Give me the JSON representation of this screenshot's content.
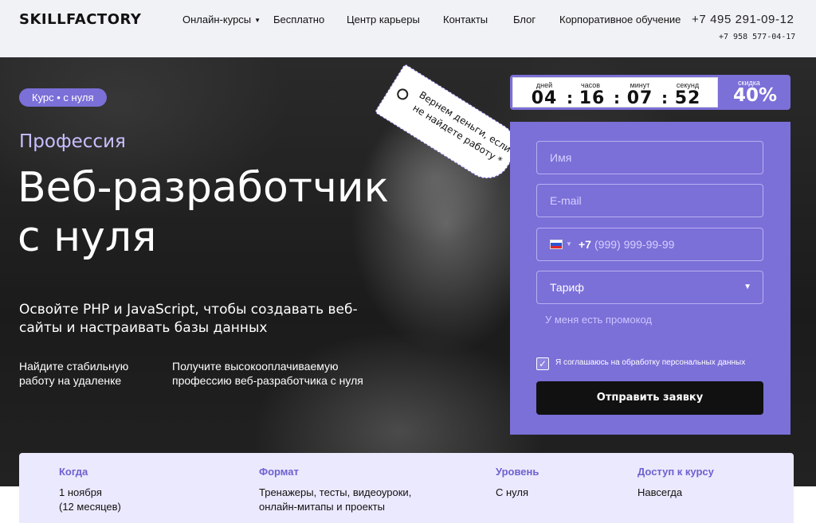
{
  "header": {
    "logo": "SKILLFACTORY",
    "nav": [
      {
        "label": "Онлайн-курсы",
        "has_dropdown": true
      },
      {
        "label": "Бесплатно"
      },
      {
        "label": "Центр карьеры"
      },
      {
        "label": "Контакты"
      },
      {
        "label": "Блог"
      },
      {
        "label": "Корпоративное обучение"
      }
    ],
    "phone_main": "+7 495 291-09-12",
    "phone_alt": "+7 958 577-04-17"
  },
  "hero": {
    "badge": "Курс • с нуля",
    "profession": "Профессия",
    "title_line1": "Веб-разработчик",
    "title_line2": "с нуля",
    "subtitle": "Освойте PHP и JavaScript, чтобы создавать веб-сайты и настраивать базы данных",
    "features": [
      "Найдите стабильную работу на удаленке",
      "Получите высокооплачиваемую профессию веб-разработчика с нуля"
    ],
    "tag_text": "Вернем деньги, если не найдете работу *"
  },
  "timer": {
    "days_label": "дней",
    "days": "04",
    "hours_label": "часов",
    "hours": "16",
    "minutes_label": "минут",
    "minutes": "07",
    "seconds_label": "секунд",
    "seconds": "52",
    "discount_label": "скидка",
    "discount": "40%"
  },
  "form": {
    "name_placeholder": "Имя",
    "email_placeholder": "E-mail",
    "phone_prefix": "+7",
    "phone_placeholder": "(999) 999-99-99",
    "tariff_label": "Тариф",
    "promo_link": "У меня есть промокод",
    "consent_text": "Я соглашаюсь на обработку персональных данных",
    "consent_checked": true,
    "submit_label": "Отправить заявку"
  },
  "info": [
    {
      "heading": "Когда",
      "value": "1 ноября\n(12 месяцев)"
    },
    {
      "heading": "Формат",
      "value": "Тренажеры, тесты, видеоуроки,\nонлайн-митапы и проекты"
    },
    {
      "heading": "Уровень",
      "value": "С нуля"
    },
    {
      "heading": "Доступ к курсу",
      "value": "Навсегда"
    }
  ],
  "colors": {
    "accent": "#7b6fd8",
    "accent_light": "#ebe9fd",
    "heading_accent": "#6d61d0"
  }
}
